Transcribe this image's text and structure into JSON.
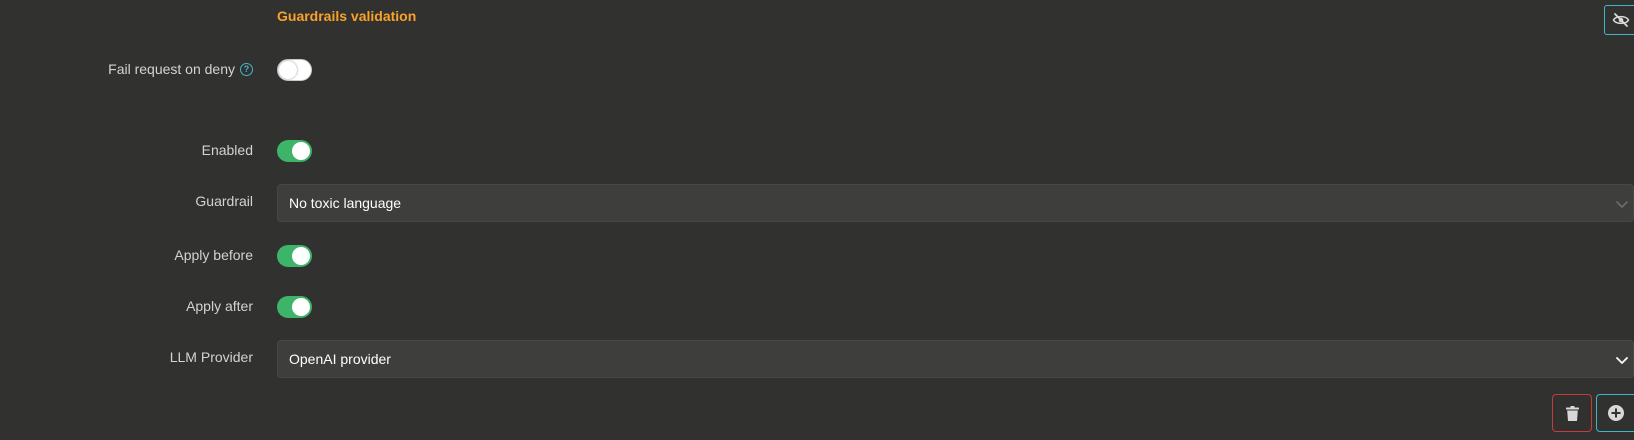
{
  "section": {
    "title": "Guardrails validation",
    "title_color": "#f9a22b",
    "visibility_icon": "eye-slash-icon"
  },
  "fail_request_on_deny": {
    "label": "Fail request on deny",
    "help_icon": "question-circle-icon",
    "help_glyph": "?",
    "enabled": false
  },
  "fields": {
    "enabled": {
      "label": "Enabled",
      "value": true
    },
    "guardrail": {
      "label": "Guardrail",
      "selected": "No toxic language",
      "chevron_icon": "chevron-down-icon"
    },
    "apply_before": {
      "label": "Apply before",
      "value": true
    },
    "apply_after": {
      "label": "Apply after",
      "value": true
    },
    "llm_provider": {
      "label": "LLM Provider",
      "selected": "OpenAI provider",
      "chevron_icon": "chevron-down-icon"
    }
  },
  "actions": {
    "delete_icon": "trash-icon",
    "add_icon": "plus-circle-icon"
  },
  "colors": {
    "background": "#313130",
    "accent": "#41b6c8",
    "toggle_on": "#3db468",
    "danger": "#c63b3b"
  }
}
